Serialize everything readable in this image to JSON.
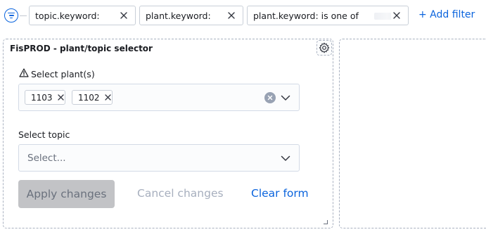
{
  "filter_bar": {
    "filters": [
      {
        "label": "topic.keyword:"
      },
      {
        "label": "plant.keyword:"
      },
      {
        "label": "plant.keyword: is one of"
      }
    ],
    "add_filter_label": "+ Add filter",
    "menu_icon": "filter-lines-icon",
    "remove_icon": "close-icon"
  },
  "panel": {
    "title": "FisPROD - plant/topic selector",
    "settings_icon": "gear-icon",
    "plants": {
      "label": "Select plant(s)",
      "warning_icon": "warning-triangle-icon",
      "selected": [
        "1103",
        "1102"
      ]
    },
    "topic": {
      "label": "Select topic",
      "placeholder": "Select..."
    },
    "buttons": {
      "apply": "Apply changes",
      "cancel": "Cancel changes",
      "clear": "Clear form"
    }
  },
  "colors": {
    "accent": "#0b64dd",
    "disabled_bg": "#c2c3c6",
    "disabled_text": "#a7afbe",
    "border": "#d3dae6"
  }
}
